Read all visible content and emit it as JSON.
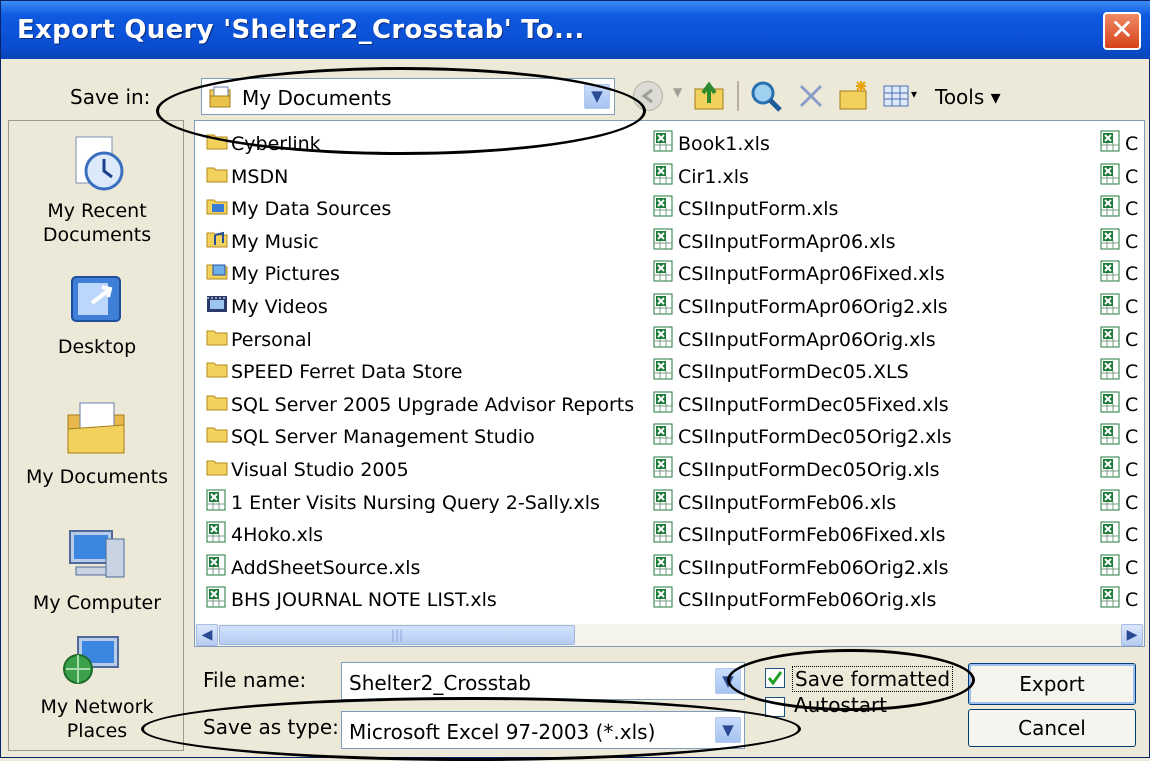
{
  "window": {
    "title": "Export Query 'Shelter2_Crosstab' To...",
    "close_glyph": "✕"
  },
  "save_in": {
    "label": "Save in:",
    "value": "My Documents"
  },
  "toolbar": {
    "tools_label": "Tools ▾",
    "view_dropdown": "▾"
  },
  "places": [
    {
      "label": "My Recent\nDocuments",
      "icon": "recent-documents-icon"
    },
    {
      "label": "Desktop",
      "icon": "desktop-icon"
    },
    {
      "label": "My Documents",
      "icon": "my-documents-icon"
    },
    {
      "label": "My Computer",
      "icon": "my-computer-icon"
    },
    {
      "label": "My Network\nPlaces",
      "icon": "network-places-icon"
    }
  ],
  "files_col1": [
    {
      "name": "Cyberlink",
      "type": "folder"
    },
    {
      "name": "MSDN",
      "type": "folder"
    },
    {
      "name": "My Data Sources",
      "type": "datasource-folder"
    },
    {
      "name": "My Music",
      "type": "music-folder"
    },
    {
      "name": "My Pictures",
      "type": "pictures-folder"
    },
    {
      "name": "My Videos",
      "type": "videos-folder"
    },
    {
      "name": "Personal",
      "type": "folder"
    },
    {
      "name": "SPEED Ferret Data Store",
      "type": "folder"
    },
    {
      "name": "SQL Server 2005 Upgrade Advisor Reports",
      "type": "folder"
    },
    {
      "name": "SQL Server Management Studio",
      "type": "folder"
    },
    {
      "name": "Visual Studio 2005",
      "type": "folder"
    },
    {
      "name": "1 Enter Visits Nursing Query 2-Sally.xls",
      "type": "excel"
    },
    {
      "name": "4Hoko.xls",
      "type": "excel"
    },
    {
      "name": "AddSheetSource.xls",
      "type": "excel"
    },
    {
      "name": "BHS JOURNAL NOTE LIST.xls",
      "type": "excel"
    }
  ],
  "files_col2": [
    {
      "name": "Book1.xls",
      "type": "excel"
    },
    {
      "name": "Cir1.xls",
      "type": "excel"
    },
    {
      "name": "CSIInputForm.xls",
      "type": "excel"
    },
    {
      "name": "CSIInputFormApr06.xls",
      "type": "excel"
    },
    {
      "name": "CSIInputFormApr06Fixed.xls",
      "type": "excel"
    },
    {
      "name": "CSIInputFormApr06Orig2.xls",
      "type": "excel"
    },
    {
      "name": "CSIInputFormApr06Orig.xls",
      "type": "excel"
    },
    {
      "name": "CSIInputFormDec05.XLS",
      "type": "excel"
    },
    {
      "name": "CSIInputFormDec05Fixed.xls",
      "type": "excel"
    },
    {
      "name": "CSIInputFormDec05Orig2.xls",
      "type": "excel"
    },
    {
      "name": "CSIInputFormDec05Orig.xls",
      "type": "excel"
    },
    {
      "name": "CSIInputFormFeb06.xls",
      "type": "excel"
    },
    {
      "name": "CSIInputFormFeb06Fixed.xls",
      "type": "excel"
    },
    {
      "name": "CSIInputFormFeb06Orig2.xls",
      "type": "excel"
    },
    {
      "name": "CSIInputFormFeb06Orig.xls",
      "type": "excel"
    }
  ],
  "files_col3_partial": "C",
  "file_name": {
    "label": "File name:",
    "value": "Shelter2_Crosstab"
  },
  "save_as_type": {
    "label": "Save as type:",
    "value": "Microsoft Excel 97-2003 (*.xls)"
  },
  "options": {
    "save_formatted_label": "Save formatted",
    "save_formatted_checked": true,
    "autostart_label": "Autostart",
    "autostart_checked": false
  },
  "buttons": {
    "export": "Export",
    "cancel": "Cancel"
  },
  "colors": {
    "titlebar": "#0a4ed1",
    "dialog_bg": "#ece9d8",
    "close": "#d6421a",
    "excel_green": "#1d7a3a",
    "folder_yellow": "#f2d15c"
  }
}
